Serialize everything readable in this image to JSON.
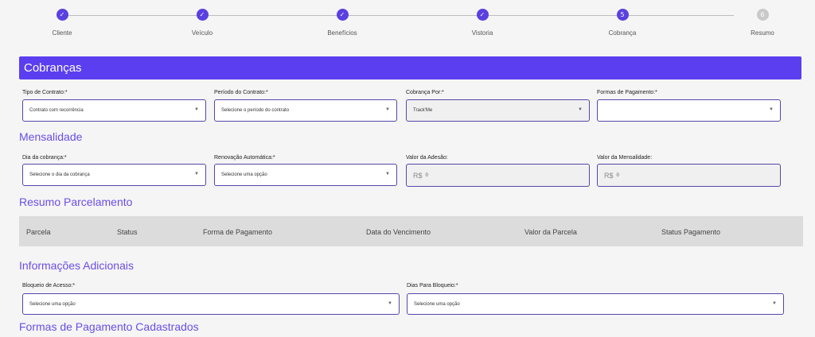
{
  "stepper": {
    "steps": [
      {
        "label": "Cliente",
        "state": "done",
        "mark": "✓"
      },
      {
        "label": "Veículo",
        "state": "done",
        "mark": "✓"
      },
      {
        "label": "Benefícios",
        "state": "done",
        "mark": "✓"
      },
      {
        "label": "Vistoria",
        "state": "done",
        "mark": "✓"
      },
      {
        "label": "Cobrança",
        "state": "active",
        "mark": "5"
      },
      {
        "label": "Resumo",
        "state": "pending",
        "mark": "6"
      }
    ]
  },
  "header": {
    "title": "Cobranças"
  },
  "contract": {
    "tipo_label": "Tipo de Contrato:*",
    "tipo_value": "Contrato com recorrência",
    "periodo_label": "Período do Contrato:*",
    "periodo_value": "Selecione o período do contrato",
    "cobranca_label": "Cobrança Por:*",
    "cobranca_value": "Track'Me",
    "formas_label": "Formas de Pagamento:*",
    "formas_value": ""
  },
  "mensalidade": {
    "title": "Mensalidade",
    "dia_label": "Dia da cobrança:*",
    "dia_value": "Selecione o dia da cobrança",
    "renovacao_label": "Renovação Automática:*",
    "renovacao_value": "Selecione uma opção",
    "adesao_label": "Valor da Adesão:",
    "adesao_prefix": "R$",
    "adesao_value": "0",
    "mensalidade_label": "Valor da Mensalidade:",
    "mensalidade_prefix": "R$",
    "mensalidade_value": "0"
  },
  "resumo": {
    "title": "Resumo Parcelamento",
    "columns": [
      "Parcela",
      "Status",
      "Forma de Pagamento",
      "Data do Vencimento",
      "Valor da Parcela",
      "Status Pagamento"
    ]
  },
  "adicionais": {
    "title": "Informações Adicionais",
    "bloqueio_label": "Bloqueio de Acesso:*",
    "bloqueio_value": "Selecione uma opção",
    "dias_label": "Dias Para Bloqueio:*",
    "dias_value": "Selecione uma opção"
  },
  "formas_cadastradas": {
    "title": "Formas de Pagamento Cadastrados"
  },
  "icons": {
    "check": "check-icon",
    "caret": "caret-down-icon"
  },
  "colors": {
    "accent": "#5b3ef0",
    "section_title": "#6a4ee6",
    "table_header": "#dcdcdc"
  }
}
